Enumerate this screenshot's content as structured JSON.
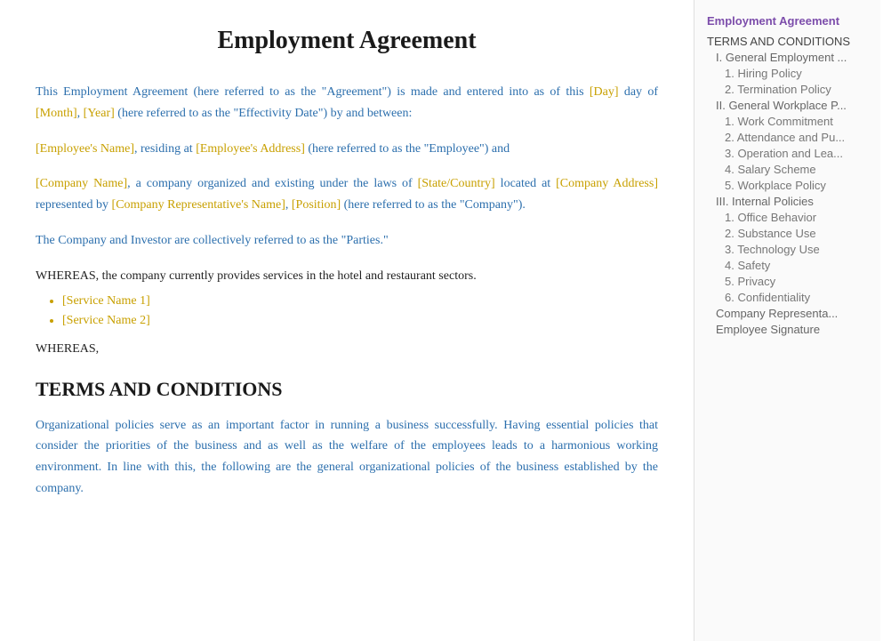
{
  "page": {
    "title": "Employment Agreement"
  },
  "content": {
    "intro": "This Employment Agreement (here referred to as the \"Agreement\") is made and entered into as of this ",
    "intro2": " day of ",
    "intro3": ", ",
    "intro4": " (here referred to as the \"Effectivity Date\") by and between:",
    "day_placeholder": "[Day]",
    "month_placeholder": "[Month]",
    "year_placeholder": "[Year]",
    "employee_line1": "",
    "employee_name_ph": "[Employee's Name]",
    "employee_addr_prefix": ", residing at ",
    "employee_addr_ph": "[Employee's Address]",
    "employee_addr_suffix": " (here referred to as the \"Employee\") and",
    "company_name_ph": "[Company Name]",
    "company_text1": ", a company organized and existing under the laws of ",
    "state_ph": "[State/Country]",
    "company_text2": " located at ",
    "company_addr_ph": "[Company Address]",
    "company_text3": " represented by ",
    "company_rep_ph": "[Company Representative's Name]",
    "company_text4": ", ",
    "position_ph": "[Position]",
    "company_text5": " (here referred to as the \"Company\").",
    "parties_text": "The Company and Investor are collectively referred to as the \"Parties.\"",
    "whereas1": "WHEREAS, the company currently provides services in the hotel and restaurant sectors.",
    "service1": "[Service Name 1]",
    "service2": "[Service Name 2]",
    "whereas2": "WHEREAS,",
    "section_title": "TERMS AND CONDITIONS",
    "org_text": "Organizational policies serve as an important factor in running a business successfully. Having essential policies that consider the priorities of the business and as well as the welfare of the employees leads to a harmonious working environment. In line with this, the following are the general organizational policies of the business established by the company."
  },
  "toc": {
    "title": "Employment Agreement",
    "items": [
      {
        "level": 1,
        "label": "TERMS AND CONDITIONS",
        "id": "terms"
      },
      {
        "level": 2,
        "label": "I. General Employment ...",
        "id": "gen-emp"
      },
      {
        "level": 3,
        "label": "1. Hiring Policy",
        "id": "hiring"
      },
      {
        "level": 3,
        "label": "2. Termination Policy",
        "id": "termination"
      },
      {
        "level": 2,
        "label": "II. General Workplace P...",
        "id": "gen-wp"
      },
      {
        "level": 3,
        "label": "1. Work Commitment",
        "id": "work-commit"
      },
      {
        "level": 3,
        "label": "2. Attendance and Pu...",
        "id": "attendance"
      },
      {
        "level": 3,
        "label": "3.  Operation and Lea...",
        "id": "operation"
      },
      {
        "level": 3,
        "label": "4. Salary Scheme",
        "id": "salary"
      },
      {
        "level": 3,
        "label": "5.  Workplace Policy",
        "id": "workplace"
      },
      {
        "level": 2,
        "label": "III. Internal Policies",
        "id": "internal"
      },
      {
        "level": 3,
        "label": "1. Office Behavior",
        "id": "office"
      },
      {
        "level": 3,
        "label": "2. Substance Use",
        "id": "substance"
      },
      {
        "level": 3,
        "label": "3. Technology Use",
        "id": "technology"
      },
      {
        "level": 3,
        "label": "4. Safety",
        "id": "safety"
      },
      {
        "level": 3,
        "label": "5. Privacy",
        "id": "privacy"
      },
      {
        "level": 3,
        "label": "6. Confidentiality",
        "id": "confidentiality"
      },
      {
        "level": 2,
        "label": "Company Representa...",
        "id": "company-rep"
      },
      {
        "level": 2,
        "label": "Employee Signature",
        "id": "emp-sig"
      }
    ]
  }
}
